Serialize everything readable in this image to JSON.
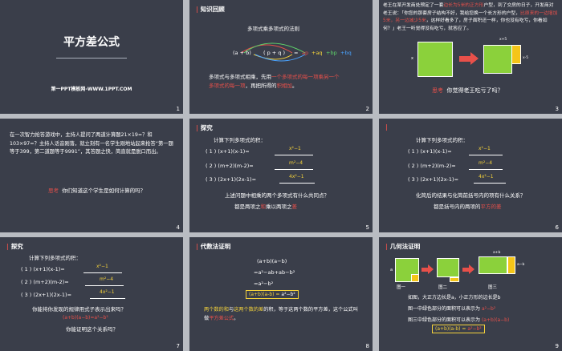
{
  "slides": {
    "s1": {
      "title": "平方差公式",
      "subtitle": "第一PPT模板网-WWW.1PPT.COM",
      "num": "1"
    },
    "s2": {
      "head": "知识回顾",
      "rule": "多项式乘多项式的法则",
      "formula_left": "(a + b)",
      "formula_mid": "( p + q )",
      "formula_eq": "=",
      "ap": "ap",
      "aq": "+aq",
      "bp": "+bp",
      "bq": "+bq",
      "text1": "多项式与多项式相乘，先用",
      "text1b": "一个多项式的每一项乘另一个",
      "text2a": "多项式的每一项",
      "text2b": "，再把所得的",
      "text2c": "积相加",
      "text2d": "。",
      "num": "2"
    },
    "s3": {
      "story": "老王在某开发商处预定了一套",
      "story_hl": "边长为5米的正方形",
      "story2": "户型，到了交房的日子，开发商对老王说：「你您的那套房子结构不好，我给您换一个长方形的户型，",
      "story_hl2": "比原来的一边增加5米，另一边减少5米",
      "story3": "，这样好看多了，房子面积还一样，你也没有吃亏，你看如何？」老王一听觉得没有吃亏，就答应了。",
      "dim_x": "x",
      "dim_top": "x+5",
      "dim_right": "x-5",
      "think": "思考",
      "question": "你觉得老王吃亏了吗？",
      "num": "3"
    },
    "s4": {
      "text": "在一次智力抢答游戏中，主持人提问了两道计算题21×19=？和103×97=？主持人话音刚落，就立刻有一名学生刚地站起来抢答“第一题等于399，第二道题等于9991”，其答题之快，简直就是脱口而出。",
      "think": "思考",
      "question": "你们知道这个学生是如何计算的吗？",
      "num": "4"
    },
    "s5": {
      "head": "探究",
      "prompt": "计算下列多项式的积：",
      "q1": "( 1 ) (x+1)(x-1)=",
      "a1": "x²−1",
      "q2": "( 2 ) (m+2)(m-2)=",
      "a2": "m²−4",
      "q3": "( 3 ) (2x+1)(2x-1)=",
      "a3": "4x²−1",
      "ask": "上述问题中相乘的两个多项式有什么共同点？",
      "concl_a": "都是两项之",
      "concl_b": "和",
      "concl_c": "乘以",
      "concl_d": "两项之",
      "concl_e": "差",
      "num": "5"
    },
    "s6": {
      "prompt": "计算下列多项式的积：",
      "q1": "( 1 ) (x+1)(x-1)=",
      "a1": "x²−1",
      "q2": "( 2 ) (m+2)(m-2)=",
      "a2": "m²−4",
      "q3": "( 3 ) (2x+1)(2x-1)=",
      "a3": "4x²−1",
      "ask": "化简后的结果与化简前括号内的项有什么关系？",
      "concl_a": "都是括号内的两项的",
      "concl_b": "平方的差",
      "num": "6"
    },
    "s7": {
      "head": "探究",
      "prompt": "计算下列多项式的积：",
      "q1": "( 1 ) (x+1)(x-1)=",
      "a1": "x²−1",
      "q2": "( 2 ) (m+2)(m-2)=",
      "a2": "m²−4",
      "q3": "( 3 ) (2x+1)(2x-1)=",
      "a3": "4x²−1",
      "ask": "你能将你发现的规律用式子表示出来吗？",
      "formula": "(a+b)(a−b)=a²−b²",
      "ask2": "你能证明这个关系吗？",
      "num": "7"
    },
    "s8": {
      "head": "代数法证明",
      "l1": "(a+b)(a−b)",
      "l2": "=a²−ab+ab−b²",
      "l3": "=a²−b²",
      "boxed": "(a+b)(a-b) =",
      "boxed_r": "a²−b²",
      "text_a": "两个数的和",
      "text_b": "与",
      "text_c": "这两个数的差",
      "text_d": "的积，等于这两个数的平方差，这个公式叫做",
      "text_e": "平方差公式",
      "text_f": "。",
      "num": "8"
    },
    "s9": {
      "head": "几何法证明",
      "fig1": "图一",
      "fig2": "图二",
      "fig3": "图三",
      "lbl_a": "a",
      "lbl_b": "b",
      "lbl_ab": "a+b",
      "lbl_amb": "a−b",
      "desc": "如图，大正方边长是a，小正方形的边长是b",
      "l1": "图一中绿色部分的面积可以表示为",
      "l1v": "a²−b²",
      "l2": "图三中绿色部分的面积可以表示为",
      "l2v": "(a+b)(a−b)",
      "final": "(a+b)(a-b) =",
      "final_r": "a²−b²",
      "num": "9"
    }
  },
  "colors": {
    "slide_bg": "#3a3e4a",
    "accent_red": "#e8504a",
    "green": "#8bd13b",
    "yellow": "#f5c518"
  }
}
